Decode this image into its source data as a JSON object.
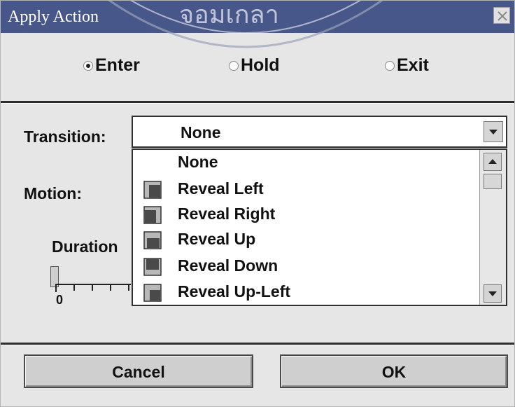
{
  "window": {
    "title": "Apply Action",
    "close_icon": "close-icon"
  },
  "watermark": {
    "text": "จอมเกล้าธนบุรี"
  },
  "action_mode": {
    "options": [
      {
        "label": "Enter",
        "selected": true
      },
      {
        "label": "Hold",
        "selected": false
      },
      {
        "label": "Exit",
        "selected": false
      }
    ]
  },
  "transition": {
    "label": "Transition:",
    "selected": "None"
  },
  "motion": {
    "label": "Motion:"
  },
  "duration": {
    "label": "Duration",
    "min_label": "0"
  },
  "transition_list": [
    {
      "label": "None",
      "icon": null
    },
    {
      "label": "Reveal Left",
      "icon": "reveal-left-icon"
    },
    {
      "label": "Reveal Right",
      "icon": "reveal-right-icon"
    },
    {
      "label": "Reveal Up",
      "icon": "reveal-up-icon"
    },
    {
      "label": "Reveal Down",
      "icon": "reveal-down-icon"
    },
    {
      "label": "Reveal Up-Left",
      "icon": "reveal-up-left-icon"
    }
  ],
  "buttons": {
    "cancel": "Cancel",
    "ok": "OK"
  },
  "colors": {
    "titlebar": "#47578a",
    "dialog_bg": "#e6e6e6",
    "button_bg": "#cfcfcf"
  }
}
